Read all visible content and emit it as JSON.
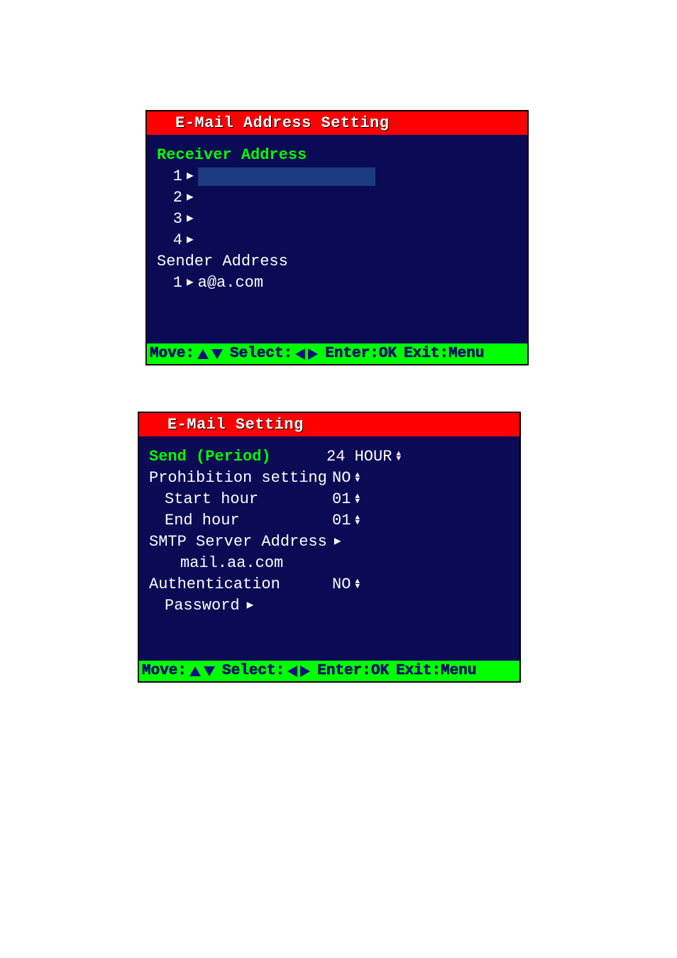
{
  "panel1": {
    "title": "E-Mail Address Setting",
    "receiver_label": "Receiver Address",
    "receivers": [
      {
        "num": "1",
        "value": ""
      },
      {
        "num": "2",
        "value": ""
      },
      {
        "num": "3",
        "value": ""
      },
      {
        "num": "4",
        "value": ""
      }
    ],
    "sender_label": "Sender Address",
    "senders": [
      {
        "num": "1",
        "value": "a@a.com"
      }
    ],
    "hints": {
      "move": "Move:",
      "select": "Select:",
      "enter": "Enter:OK",
      "exit": "Exit:Menu"
    }
  },
  "panel2": {
    "title": "E-Mail Setting",
    "items": {
      "send_period_label": "Send (Period)",
      "send_period_value": "24 HOUR",
      "prohibition_label": "Prohibition setting",
      "prohibition_value": "NO",
      "start_label": "Start hour",
      "start_value": "01",
      "end_label": "End hour",
      "end_value": "01",
      "smtp_label": "SMTP Server Address",
      "smtp_value": "mail.aa.com",
      "auth_label": "Authentication",
      "auth_value": "NO",
      "password_label": "Password"
    },
    "hints": {
      "move": "Move:",
      "select": "Select:",
      "enter": "Enter:OK",
      "exit": "Exit:Menu"
    }
  }
}
